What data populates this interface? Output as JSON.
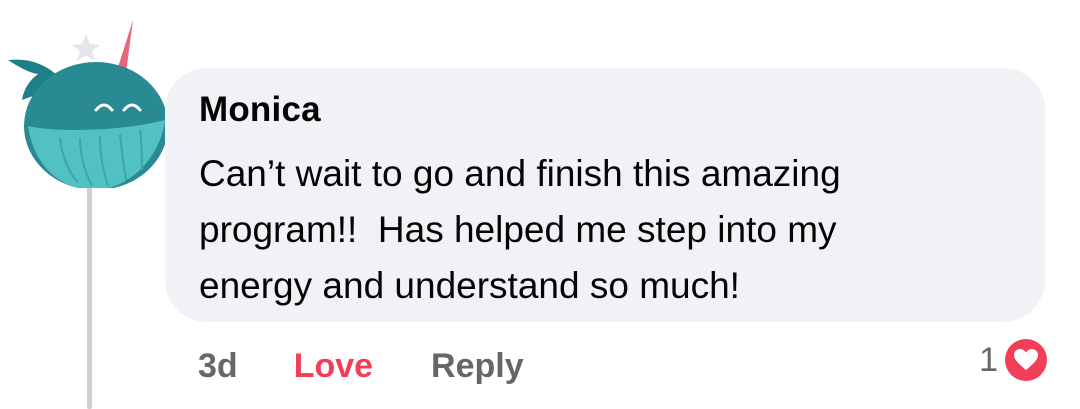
{
  "comment": {
    "author": "Monica",
    "text_lines": [
      "Can’t wait to go and finish this amazing",
      "program!!  Has helped me step into my",
      "energy and understand so much!"
    ],
    "avatar_icon": "narwhal-avatar-icon"
  },
  "actions": {
    "time": "3d",
    "love_label": "Love",
    "reply_label": "Reply"
  },
  "reactions": {
    "count": "1",
    "icon": "heart-icon"
  },
  "colors": {
    "love": "#f33e58",
    "meta": "#65676b",
    "bubble": "#f0f2f5",
    "text": "#050505"
  }
}
